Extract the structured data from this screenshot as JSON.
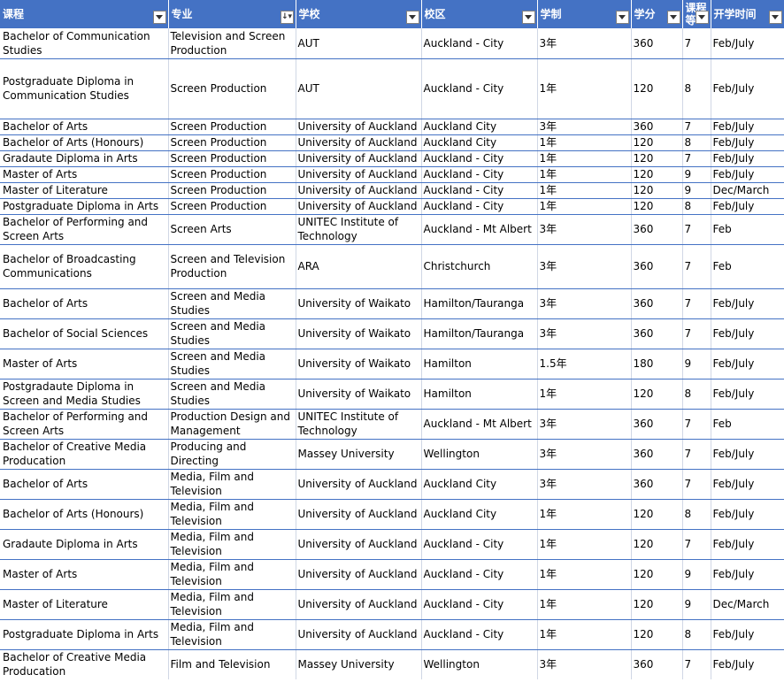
{
  "headers": [
    "课程",
    "专业",
    "学校",
    "校区",
    "学制",
    "学分",
    "课程等",
    "开学时间"
  ],
  "rows": [
    [
      "Bachelor of Communication Studies",
      "Television and Screen Production",
      "AUT",
      "Auckland - City",
      "3年",
      "360",
      "7",
      "Feb/July"
    ],
    [
      "Postgraduate Diploma in Communication Studies",
      "Screen Production",
      "AUT",
      "Auckland - City",
      "1年",
      "120",
      "8",
      "Feb/July"
    ],
    [
      "Bachelor of Arts",
      "Screen Production",
      "University of Auckland",
      "Auckland City",
      "3年",
      "360",
      "7",
      "Feb/July"
    ],
    [
      "Bachelor of Arts (Honours)",
      "Screen Production",
      "University of Auckland",
      "Auckland City",
      "1年",
      "120",
      "8",
      "Feb/July"
    ],
    [
      "Gradaute Diploma in Arts",
      "Screen Production",
      "University of Auckland",
      "Auckland - City",
      "1年",
      "120",
      "7",
      "Feb/July"
    ],
    [
      "Master of Arts",
      "Screen Production",
      "University of Auckland",
      "Auckland - City",
      "1年",
      "120",
      "9",
      "Feb/July"
    ],
    [
      "Master of Literature",
      "Screen Production",
      "University of Auckland",
      "Auckland - City",
      "1年",
      "120",
      "9",
      "Dec/March"
    ],
    [
      "Postgraduate Diploma in Arts",
      "Screen Production",
      "University of Auckland",
      "Auckland - City",
      "1年",
      "120",
      "8",
      "Feb/July"
    ],
    [
      "Bachelor of Performing and Screen Arts",
      "Screen Arts",
      "UNITEC Institute of Technology",
      "Auckland - Mt Albert",
      "3年",
      "360",
      "7",
      "Feb"
    ],
    [
      "Bachelor of Broadcasting Communications",
      "Screen and Television Production",
      "ARA",
      "Christchurch",
      "3年",
      "360",
      "7",
      "Feb"
    ],
    [
      "Bachelor of Arts",
      "Screen and Media Studies",
      "University of Waikato",
      "Hamilton/Tauranga",
      "3年",
      "360",
      "7",
      "Feb/July"
    ],
    [
      "Bachelor of Social Sciences",
      "Screen and Media Studies",
      "University of Waikato",
      "Hamilton/Tauranga",
      "3年",
      "360",
      "7",
      "Feb/July"
    ],
    [
      "Master of Arts",
      "Screen and Media Studies",
      "University of Waikato",
      "Hamilton",
      "1.5年",
      "180",
      "9",
      "Feb/July"
    ],
    [
      "Postgradaute Diploma in Screen and Media Studies",
      "Screen and Media Studies",
      "University of Waikato",
      "Hamilton",
      "1年",
      "120",
      "8",
      "Feb/July"
    ],
    [
      "Bachelor of Performing and Screen Arts",
      "Production Design and Management",
      "UNITEC Institute of Technology",
      "Auckland - Mt Albert",
      "3年",
      "360",
      "7",
      "Feb"
    ],
    [
      "Bachelor of Creative Media Producation",
      "Producing and Directing",
      "Massey University",
      "Wellington",
      "3年",
      "360",
      "7",
      "Feb/July"
    ],
    [
      "Bachelor of Arts",
      "Media, Film and Television",
      "University of Auckland",
      "Auckland City",
      "3年",
      "360",
      "7",
      "Feb/July"
    ],
    [
      "Bachelor of Arts (Honours)",
      "Media, Film and Television",
      "University of Auckland",
      "Auckland City",
      "1年",
      "120",
      "8",
      "Feb/July"
    ],
    [
      "Gradaute Diploma in Arts",
      "Media, Film and Television",
      "University of Auckland",
      "Auckland - City",
      "1年",
      "120",
      "7",
      "Feb/July"
    ],
    [
      "Master of Arts",
      "Media, Film and Television",
      "University of Auckland",
      "Auckland - City",
      "1年",
      "120",
      "9",
      "Feb/July"
    ],
    [
      "Master of Literature",
      "Media, Film and Television",
      "University of Auckland",
      "Auckland - City",
      "1年",
      "120",
      "9",
      "Dec/March"
    ],
    [
      "Postgraduate Diploma in Arts",
      "Media, Film and Television",
      "University of Auckland",
      "Auckland - City",
      "1年",
      "120",
      "8",
      "Feb/July"
    ],
    [
      "Bachelor of Creative Media Producation",
      "Film and Television",
      "Massey University",
      "Wellington",
      "3年",
      "360",
      "7",
      "Feb/July"
    ]
  ],
  "sorted_column": 1,
  "colors": {
    "header_bg": "#4472c4",
    "header_text": "#ffffff",
    "row_border": "#4472c4"
  },
  "icons": {
    "filter": "filter-dropdown-icon",
    "sorted_filter": "sort-filter-icon"
  }
}
